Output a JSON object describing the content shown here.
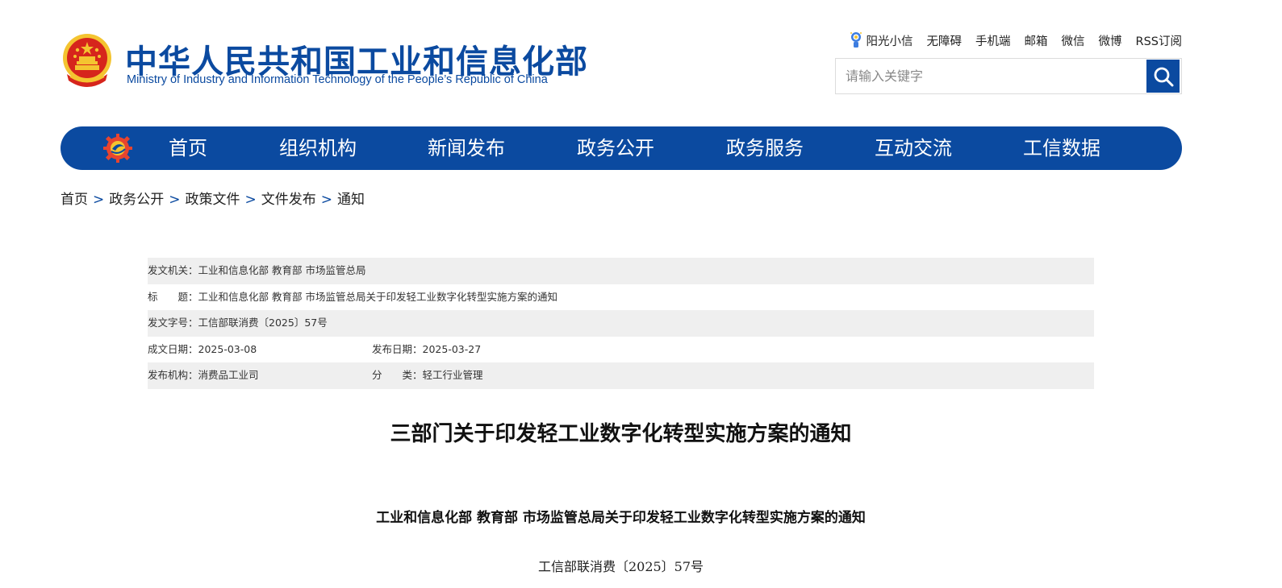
{
  "site": {
    "name_cn": "中华人民共和国工业和信息化部",
    "name_en": "Ministry of Industry and Information Technology of the People’s Republic of China"
  },
  "toplinks": [
    "阳光小信",
    "无障碍",
    "手机端",
    "邮箱",
    "微信",
    "微博",
    "RSS订阅"
  ],
  "search": {
    "placeholder": "请输入关键字",
    "value": ""
  },
  "nav": {
    "items": [
      "首页",
      "组织机构",
      "新闻发布",
      "政务公开",
      "政务服务",
      "互动交流",
      "工信数据"
    ]
  },
  "breadcrumb": [
    "首页",
    "政务公开",
    "政策文件",
    "文件发布",
    "通知"
  ],
  "breadcrumb_sep": ">",
  "meta": {
    "issuer_label": "发文机关：",
    "issuer_value": "工业和信息化部 教育部 市场监管总局",
    "title_label": "标　　题：",
    "title_value": "工业和信息化部 教育部 市场监管总局关于印发轻工业数字化转型实施方案的通知",
    "docno_label": "发文字号：",
    "docno_value": "工信部联消费〔2025〕57号",
    "written_label": "成文日期：",
    "written_value": "2025-03-08",
    "published_label": "发布日期：",
    "published_value": "2025-03-27",
    "org_label": "发布机构：",
    "org_value": "消费品工业司",
    "category_label": "分　　类：",
    "category_value": "轻工行业管理"
  },
  "document": {
    "title": "三部门关于印发轻工业数字化转型实施方案的通知",
    "subtitle": "工业和信息化部  教育部  市场监管总局关于印发轻工业数字化转型实施方案的通知",
    "number": "工信部联消费〔2025〕57号"
  },
  "colors": {
    "brand_blue": "#0b4aa0",
    "meta_shade": "#efefef",
    "emblem_red": "#d6251c",
    "emblem_gold": "#f4c430"
  },
  "icons": {
    "emblem": "national-emblem-icon",
    "sun": "sun-robot-icon",
    "search": "search-icon",
    "nav_logo": "ministry-gear-logo-icon"
  }
}
